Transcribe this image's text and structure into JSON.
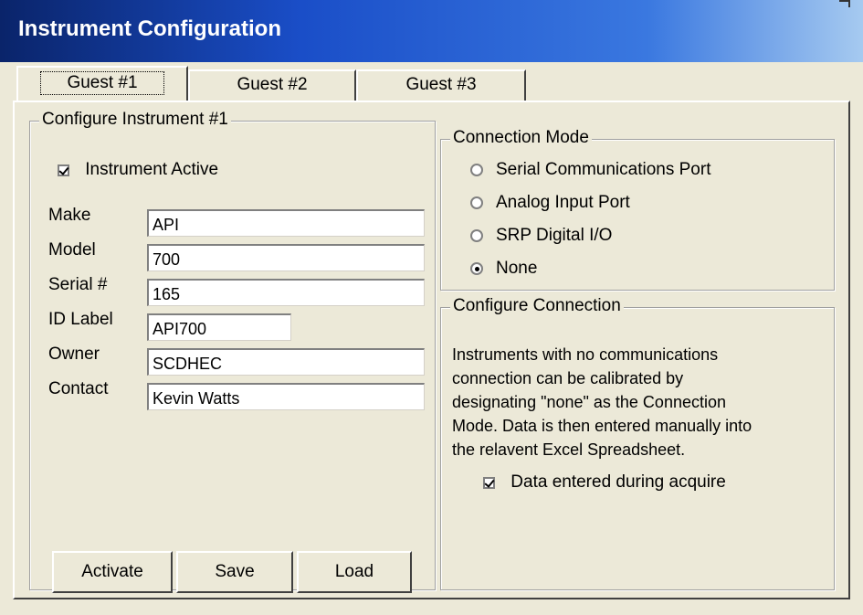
{
  "window": {
    "title": "Instrument Configuration"
  },
  "tabs": [
    {
      "label": "Guest #1",
      "active": true
    },
    {
      "label": "Guest #2",
      "active": false
    },
    {
      "label": "Guest #3",
      "active": false
    }
  ],
  "instrument": {
    "group_label": "Configure Instrument #1",
    "active_label": "Instrument Active",
    "active_checked": true,
    "fields": [
      {
        "label": "Make",
        "value": "API"
      },
      {
        "label": "Model",
        "value": "700"
      },
      {
        "label": "Serial #",
        "value": "165"
      },
      {
        "label": "ID Label",
        "value": "API700"
      },
      {
        "label": "Owner",
        "value": "SCDHEC"
      },
      {
        "label": "Contact",
        "value": "Kevin Watts"
      }
    ],
    "buttons": {
      "activate": "Activate",
      "save": "Save",
      "load": "Load"
    }
  },
  "connection_mode": {
    "group_label": "Connection Mode",
    "options": [
      {
        "label": "Serial Communications Port",
        "selected": false
      },
      {
        "label": "Analog Input Port",
        "selected": false
      },
      {
        "label": "SRP Digital I/O",
        "selected": false
      },
      {
        "label": "None",
        "selected": true
      }
    ]
  },
  "configure_connection": {
    "group_label": "Configure Connection",
    "lines": [
      "Instruments with no communications",
      "connection can be calibrated by",
      "designating \"none\" as the Connection",
      "Mode.  Data is then entered manually into",
      "the relavent Excel Spreadsheet."
    ],
    "data_entered_label": "Data entered during acquire",
    "data_entered_checked": true
  }
}
